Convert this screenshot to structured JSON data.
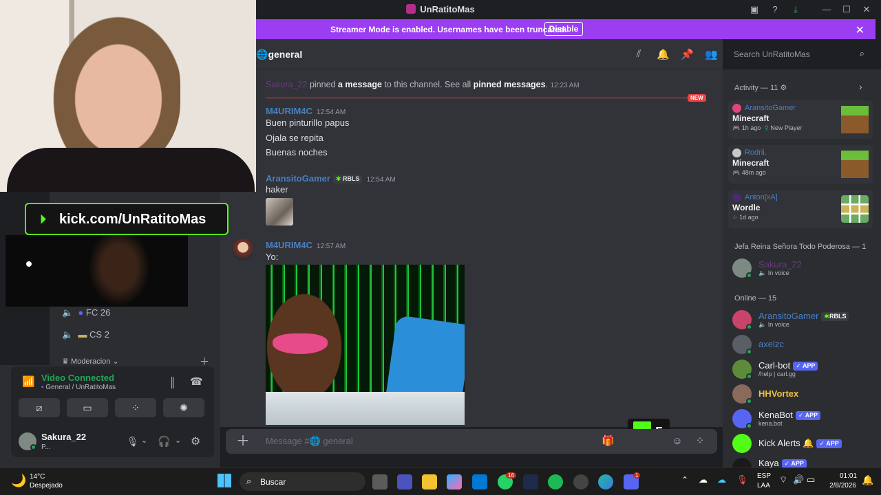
{
  "window": {
    "title": "UnRatitoMas"
  },
  "streamer_banner": {
    "message": "Streamer Mode is enabled. Usernames have been truncated.",
    "disable_label": "Disable"
  },
  "channel": {
    "name": "general",
    "search_placeholder": "Search UnRatitoMas"
  },
  "messages": {
    "system": {
      "user": "Sakura_22",
      "text1": "pinned",
      "link1": "a message",
      "text2": "to this channel. See all",
      "link2": "pinned messages",
      "time": "12:23 AM",
      "new_badge": "NEW"
    },
    "m1": {
      "user": "M4URIM4C",
      "time": "12:54 AM",
      "lines": [
        "Buen pinturillo papus",
        "Ojala se repita",
        "Buenas noches"
      ]
    },
    "m2": {
      "user": "AransitoGamer",
      "tag": "RBLS",
      "time": "12:54 AM",
      "text": "haker"
    },
    "m3": {
      "user": "M4URIM4C",
      "time": "12:57 AM",
      "text": "Yo:"
    }
  },
  "composer": {
    "placeholder": "Message #🌐 general"
  },
  "kick_overlay": {
    "url": "kick.com/UnRatitoMas",
    "viewers": "5"
  },
  "left_panel": {
    "channels": [
      {
        "name": "FC 26"
      },
      {
        "name": "CS 2"
      }
    ],
    "category": "Moderacion",
    "voice": {
      "status": "Video Connected",
      "location": "General / UnRatitoMas"
    },
    "user": {
      "name": "Sakura_22",
      "status": "P..."
    }
  },
  "activity": {
    "header": "Activity — 11",
    "cards": [
      {
        "user": "AransitoGamer",
        "game": "Minecraft",
        "time": "1h ago",
        "extra": "New Player"
      },
      {
        "user": "Rodrii.",
        "game": "Minecraft",
        "time": "48m ago"
      },
      {
        "user": "Anton[xA]",
        "game": "Wordle",
        "time": "1d ago"
      }
    ]
  },
  "members": {
    "role_header": "Jefa Reina Señora Todo Poderosa — 1",
    "role_member": {
      "name": "Sakura_22",
      "status": "In voice"
    },
    "online_header": "Online — 15",
    "online": [
      {
        "name": "AransitoGamer",
        "tag": "RBLS",
        "status": "In voice"
      },
      {
        "name": "axelzc"
      },
      {
        "name": "Carl-bot",
        "tag": "APP",
        "status": "/help | carl.gg"
      },
      {
        "name": "HHVortex"
      },
      {
        "name": "KenaBot",
        "tag": "APP",
        "status": "kena.bot"
      },
      {
        "name": "Kick Alerts 🔔",
        "tag": "APP"
      },
      {
        "name": "Kaya",
        "tag": "APP"
      }
    ]
  },
  "taskbar": {
    "weather_temp": "14°C",
    "weather_desc": "Despejado",
    "search_label": "Buscar",
    "lang": "ESP",
    "lang2": "LAA",
    "time": "01:01",
    "date": "2/8/2026",
    "badge_whatsapp": "16",
    "badge_discord": "1"
  }
}
